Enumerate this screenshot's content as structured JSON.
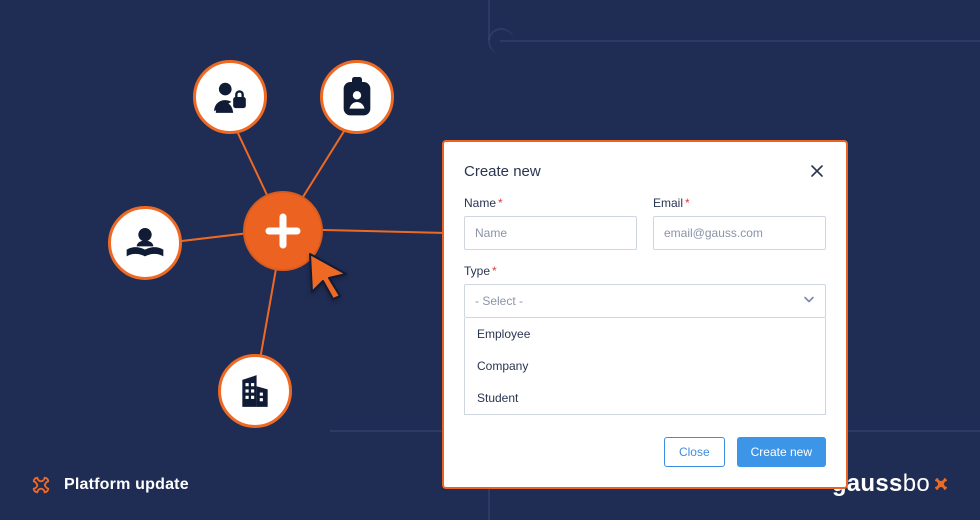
{
  "footer": {
    "left_label": "Platform update",
    "brand_bold": "gauss",
    "brand_thin": "bo"
  },
  "dialog": {
    "title": "Create new",
    "name": {
      "label": "Name",
      "placeholder": "Name"
    },
    "email": {
      "label": "Email",
      "placeholder": "email@gauss.com"
    },
    "type": {
      "label": "Type",
      "selected": "- Select -",
      "options": [
        "Employee",
        "Company",
        "Student"
      ]
    },
    "actions": {
      "close": "Close",
      "create": "Create new"
    }
  },
  "required_mark": "*",
  "nodes": {
    "topLeft": "user-lock-icon",
    "topRight": "id-badge-icon",
    "left": "reader-icon",
    "bottom": "building-icon",
    "hub": "plus-icon"
  }
}
